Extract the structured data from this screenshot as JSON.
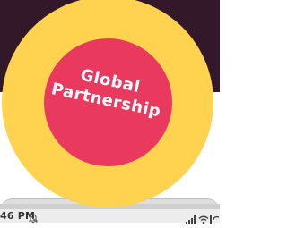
{
  "badge": {
    "line1": "Global",
    "line2": "Partnership"
  },
  "status_bar": {
    "time": "46 PM"
  },
  "colors": {
    "top_background": "#33182a",
    "badge_outer": "#ffd34f",
    "badge_inner": "#e9395f",
    "status_bar": "#ededed"
  },
  "icons": {
    "bell": "bell-off-icon",
    "signal": "signal-icon",
    "wifi": "wifi-icon"
  }
}
